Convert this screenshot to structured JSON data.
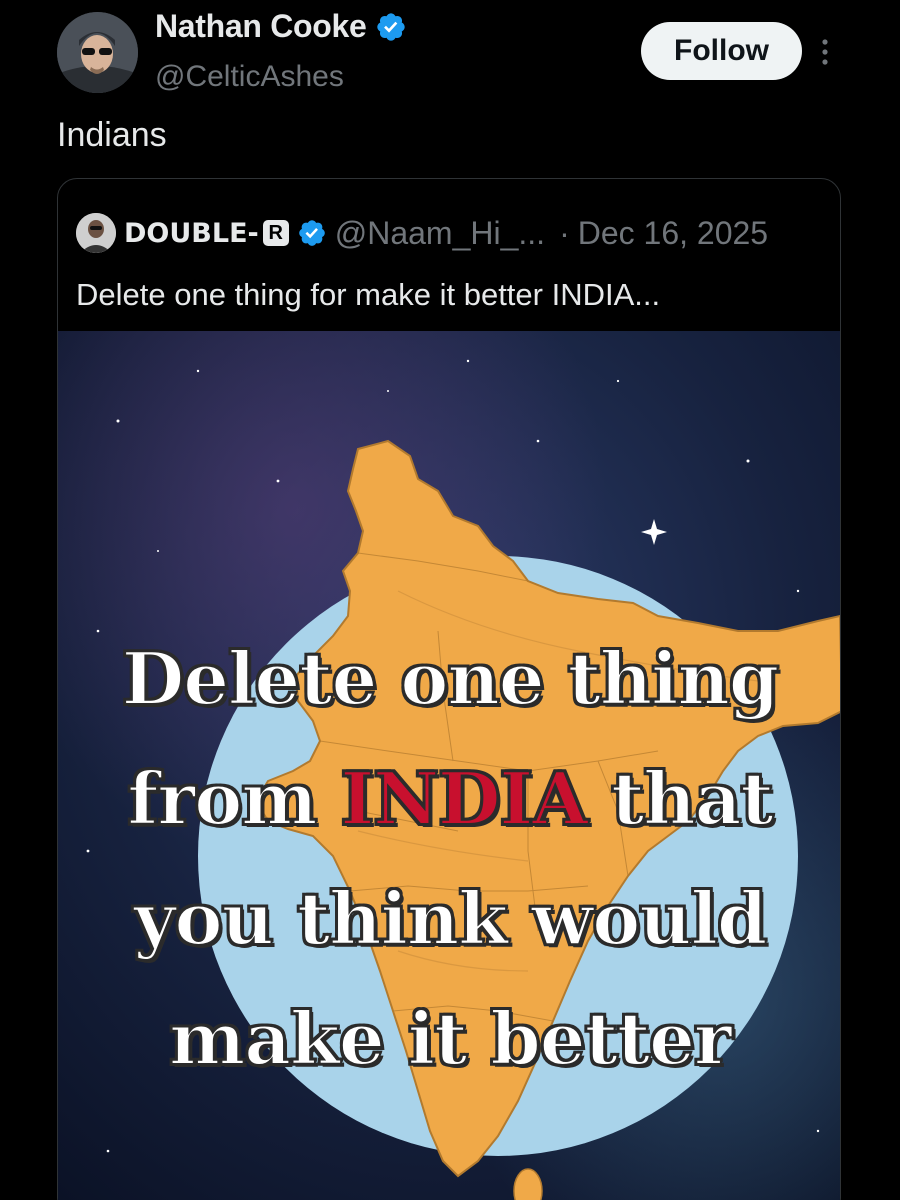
{
  "author": {
    "display_name": "Nathan Cooke",
    "handle": "@CelticAshes",
    "verified": true,
    "avatar_icon": "profile-photo"
  },
  "actions": {
    "follow_label": "Follow",
    "more_icon": "more-vertical-icon"
  },
  "tweet": {
    "text": "Indians"
  },
  "quoted": {
    "display_name": "DOUBLE-",
    "badge": "R",
    "verified": true,
    "handle": "@Naam_Hi_...",
    "separator": "·",
    "date": "Dec 16, 2025",
    "text": "Delete one thing for make it better INDIA...",
    "media": {
      "line1": "Delete one thing",
      "line2_pre": "from ",
      "line2_accent": "INDIA",
      "line2_post": " that",
      "line3": "you think would",
      "line4": "make it better"
    }
  },
  "colors": {
    "background": "#000000",
    "text": "#e7e9ea",
    "muted": "#71767b",
    "verified_blue": "#1d9bf0",
    "accent_red": "#c8102e",
    "map_orange": "#f0a948",
    "globe_blue": "#a9d3ea"
  }
}
